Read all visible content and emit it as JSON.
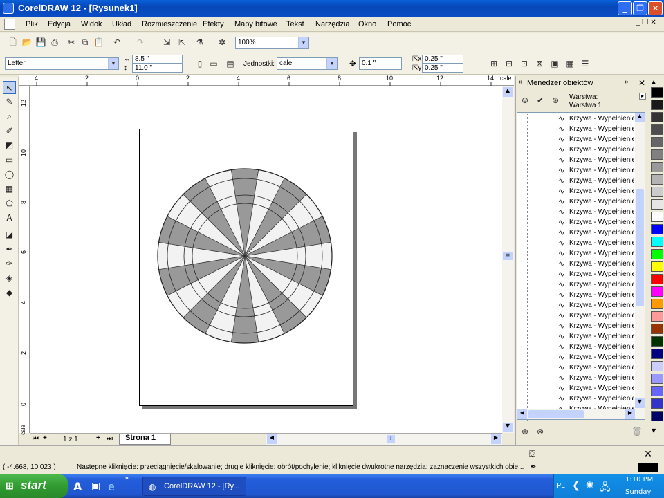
{
  "window": {
    "title": "CorelDRAW 12 - [Rysunek1]"
  },
  "menu": [
    "Plik",
    "Edycja",
    "Widok",
    "Układ",
    "Rozmieszczenie",
    "Efekty",
    "Mapy bitowe",
    "Tekst",
    "Narzędzia",
    "Okno",
    "Pomoc"
  ],
  "standard_toolbar": {
    "zoom": "100%"
  },
  "property_bar": {
    "paper": "Letter",
    "width": "8.5 \"",
    "height": "11.0 \"",
    "units_label": "Jednostki:",
    "units": "cale",
    "nudge": "0.1 \"",
    "dup_x": "0.25 \"",
    "dup_y": "0.25 \""
  },
  "ruler": {
    "h_ticks": [
      "4",
      "2",
      "0",
      "2",
      "4",
      "6",
      "8",
      "10",
      "12",
      "14"
    ],
    "h_unit": "cale",
    "v_ticks": [
      "12",
      "10",
      "8",
      "6",
      "4",
      "2",
      "0"
    ],
    "v_unit": "cale"
  },
  "page_nav": {
    "counter": "1 z 1",
    "tab": "Strona 1"
  },
  "docker": {
    "title": "Menedżer obiektów",
    "layer_label": "Warstwa:",
    "layer_name": "Warstwa 1",
    "items": [
      "Krzywa - Wypełnienie",
      "Krzywa - Wypełnienie",
      "Krzywa - Wypełnienie",
      "Krzywa - Wypełnienie",
      "Krzywa - Wypełnienie",
      "Krzywa - Wypełnienie",
      "Krzywa - Wypełnienie",
      "Krzywa - Wypełnienie",
      "Krzywa - Wypełnienie",
      "Krzywa - Wypełnienie",
      "Krzywa - Wypełnienie",
      "Krzywa - Wypełnienie",
      "Krzywa - Wypełnienie",
      "Krzywa - Wypełnienie",
      "Krzywa - Wypełnienie",
      "Krzywa - Wypełnienie",
      "Krzywa - Wypełnienie",
      "Krzywa - Wypełnienie",
      "Krzywa - Wypełnienie",
      "Krzywa - Wypełnienie",
      "Krzywa - Wypełnienie",
      "Krzywa - Wypełnienie",
      "Krzywa - Wypełnienie",
      "Krzywa - Wypełnienie",
      "Krzywa - Wypełnienie",
      "Krzywa - Wypełnienie",
      "Krzywa - Wypełnienie",
      "Krzywa - Wypełnienie",
      "Krzywa - Wypełnienie"
    ]
  },
  "palette": [
    "#000000",
    "#1a1a1a",
    "#333333",
    "#4d4d4d",
    "#666666",
    "#808080",
    "#999999",
    "#b3b3b3",
    "#cccccc",
    "#e6e6e6",
    "#ffffff",
    "#0000ff",
    "#00ffff",
    "#00ff00",
    "#ffff00",
    "#ff0000",
    "#ff00ff",
    "#ff9900",
    "#ff9999",
    "#993300",
    "#003300",
    "#000080",
    "#ccccff",
    "#9999ff",
    "#6666ff",
    "#3333cc",
    "#000066"
  ],
  "status": {
    "coords": "( -4.668, 10.023 )",
    "message": "Następne kliknięcie: przeciągnięcie/skalowanie; drugie kliknięcie: obrót/pochylenie; kliknięcie dwukrotne narzędzia: zaznaczenie wszystkich obie..."
  },
  "taskbar": {
    "start": "start",
    "task": "CorelDRAW 12 - [Ry...",
    "lang": "PL",
    "time": "1:10 PM",
    "day": "Sunday"
  },
  "drawing": {
    "fill_dark": "#999999",
    "fill_light": "#f2f2f2"
  }
}
